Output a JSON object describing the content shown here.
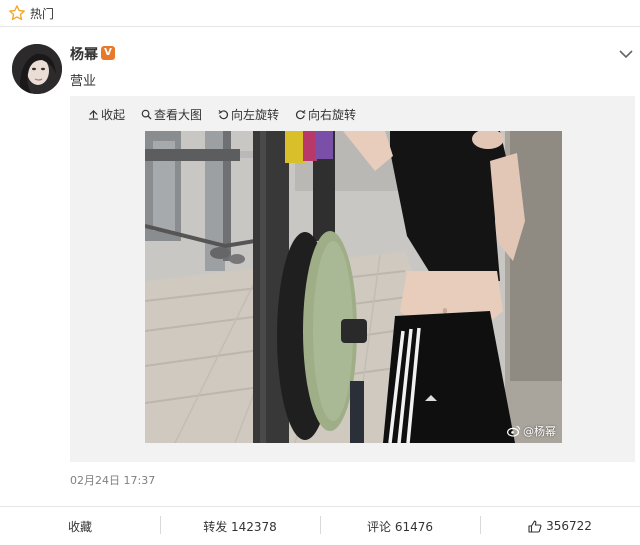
{
  "header": {
    "label": "热门",
    "icon": "star-outline-icon"
  },
  "post": {
    "username": "杨幂",
    "verified_badge": "V",
    "text": "营业",
    "timestamp": "02月24日 17:37"
  },
  "media_tools": {
    "collapse": "收起",
    "view_large": "查看大图",
    "rotate_left": "向左旋转",
    "rotate_right": "向右旋转"
  },
  "photo": {
    "watermark": "@杨幂"
  },
  "actions": {
    "favorite": "收藏",
    "repost": "转发 142378",
    "comment": "评论 61476",
    "like_count": "356722"
  },
  "colors": {
    "accent_orange": "#e8792b",
    "star": "#f5a623",
    "panel_bg": "#f2f2f2"
  }
}
